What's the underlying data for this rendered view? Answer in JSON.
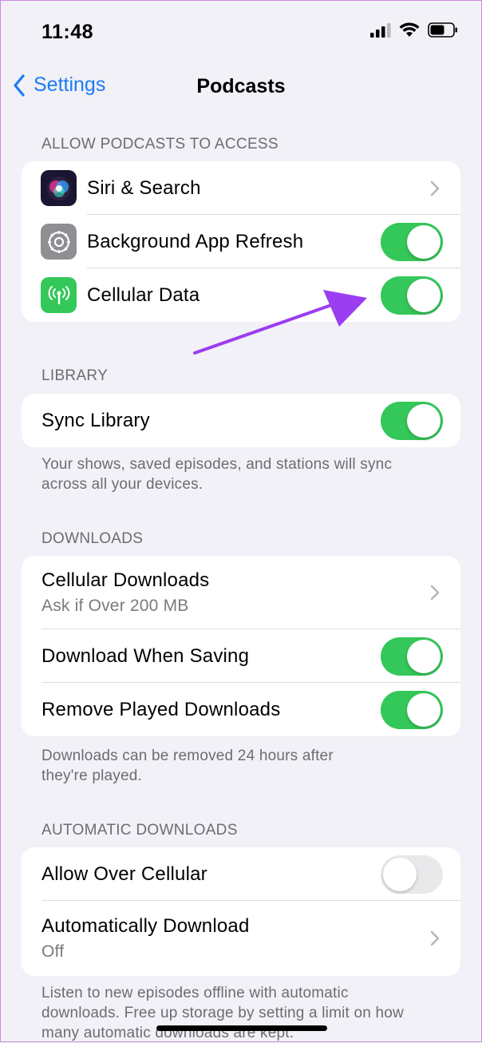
{
  "status_bar": {
    "time": "11:48"
  },
  "nav": {
    "back_label": "Settings",
    "title": "Podcasts"
  },
  "sections": {
    "access": {
      "header": "ALLOW PODCASTS TO ACCESS",
      "siri": {
        "label": "Siri & Search",
        "icon": "siri-icon"
      },
      "background_refresh": {
        "label": "Background App Refresh",
        "icon": "gear-icon",
        "on": true
      },
      "cellular_data": {
        "label": "Cellular Data",
        "icon": "antenna-icon",
        "on": true
      }
    },
    "library": {
      "header": "LIBRARY",
      "sync": {
        "label": "Sync Library",
        "on": true
      },
      "note_line1": "Your shows, saved episodes, and stations will sync",
      "note_line2": "across all your devices."
    },
    "downloads": {
      "header": "DOWNLOADS",
      "cellular_downloads": {
        "label": "Cellular Downloads",
        "value": "Ask if Over 200 MB"
      },
      "download_when_saving": {
        "label": "Download When Saving",
        "on": true
      },
      "remove_played": {
        "label": "Remove Played Downloads",
        "on": true
      },
      "note_line1": "Downloads can be removed 24 hours after",
      "note_line2": "they're played."
    },
    "automatic": {
      "header": "AUTOMATIC DOWNLOADS",
      "allow_cellular": {
        "label": "Allow Over Cellular",
        "on": false
      },
      "auto_download": {
        "label": "Automatically Download",
        "value": "Off"
      },
      "note_line1": "Listen to new episodes offline with automatic",
      "note_line2": "downloads. Free up storage by setting a limit on how",
      "note_line3": "many automatic downloads are kept."
    }
  },
  "colors": {
    "accent": "#1a7cf5",
    "toggle_on": "#34c759",
    "arrow": "#9b3df0"
  }
}
